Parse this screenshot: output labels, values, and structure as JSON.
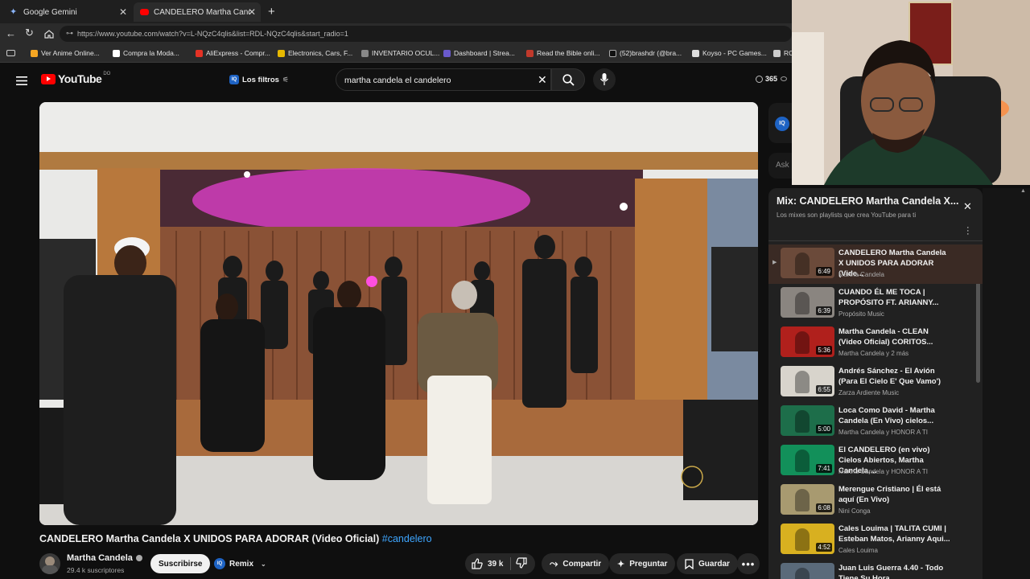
{
  "tabs": [
    {
      "label": "Google Gemini"
    },
    {
      "label": "CANDELERO Martha Candela X UN"
    }
  ],
  "address": {
    "url": "https://www.youtube.com/watch?v=L-NQzC4qlis&list=RDL-NQzC4qlis&start_radio=1"
  },
  "bookmarks": [
    {
      "label": "Ver Anime Online..."
    },
    {
      "label": "Compra la Moda..."
    },
    {
      "label": "AliExpress - Compr..."
    },
    {
      "label": "Electronics, Cars, F..."
    },
    {
      "label": "INVENTARIO OCUL..."
    },
    {
      "label": "Dashboard | Strea..."
    },
    {
      "label": "Read the Bible onli..."
    },
    {
      "label": "(52)brashdr (@bra..."
    },
    {
      "label": "Koyso - PC Games..."
    },
    {
      "label": "RC"
    }
  ],
  "header": {
    "logo_text": "YouTube",
    "country": "DO",
    "filters_label": "Los filtros",
    "search_value": "martha candela el candelero",
    "view_count": "365"
  },
  "video": {
    "title": "CANDELERO Martha Candela X UNIDOS PARA ADORAR (Video Oficial)",
    "hashtag": "#candelero",
    "channel": "Martha Candela",
    "subscribers": "29.4 k suscriptores",
    "subscribe_label": "Suscribirse",
    "remix_label": "Remix",
    "likes": "39 k",
    "share_label": "Compartir",
    "ask_label": "Preguntar",
    "save_label": "Guardar"
  },
  "side": {
    "ask_placeholder": "Ask"
  },
  "playlist": {
    "title": "Mix: CANDELERO Martha Candela X...",
    "subtitle": "Los mixes son playlists que crea YouTube para ti",
    "items": [
      {
        "title": "CANDELERO Martha Candela X UNIDOS PARA ADORAR (Vide...",
        "channel": "Martha Candela",
        "duration": "6:49",
        "color": "#6b4a3a"
      },
      {
        "title": "CUANDO ÉL ME TOCA | PROPÓSITO FT. ARIANNY...",
        "channel": "Propósito Music",
        "duration": "6:39",
        "color": "#8a8580"
      },
      {
        "title": "Martha Candela - CLEAN (Video Oficial) CORITOS...",
        "channel": "Martha Candela y 2 más",
        "duration": "5:36",
        "color": "#b0201c"
      },
      {
        "title": "Andrés Sánchez - El Avión (Para El Cielo E' Que Vamo')",
        "channel": "Zarza Ardiente Music",
        "duration": "6:55",
        "color": "#d8d4cc"
      },
      {
        "title": "Loca Como David - Martha Candela (En Vivo) cielos...",
        "channel": "Martha Candela y HONOR A TI",
        "duration": "5:00",
        "color": "#1d6e4a"
      },
      {
        "title": "El CANDELERO (en vivo) Cielos Abiertos, Martha Candela,...",
        "channel": "Martha Candela y HONOR A TI",
        "duration": "7:41",
        "color": "#12905a"
      },
      {
        "title": "Merengue Cristiano | Él está aquí (En Vivo)",
        "channel": "Nini Conga",
        "duration": "6:08",
        "color": "#a89a70"
      },
      {
        "title": "Cales Louima | TALITA CUMI | Esteban Matos, Arianny Aqui...",
        "channel": "Cales Louima",
        "duration": "4:52",
        "color": "#d8b020"
      },
      {
        "title": "Juan Luis Guerra 4.40 - Todo Tiene Su Hora",
        "channel": "",
        "duration": "",
        "color": "#5a6a7a"
      }
    ]
  },
  "colors": {
    "accent": "#3ea6ff",
    "brand": "#ff0000",
    "bg": "#0f0f0f"
  }
}
